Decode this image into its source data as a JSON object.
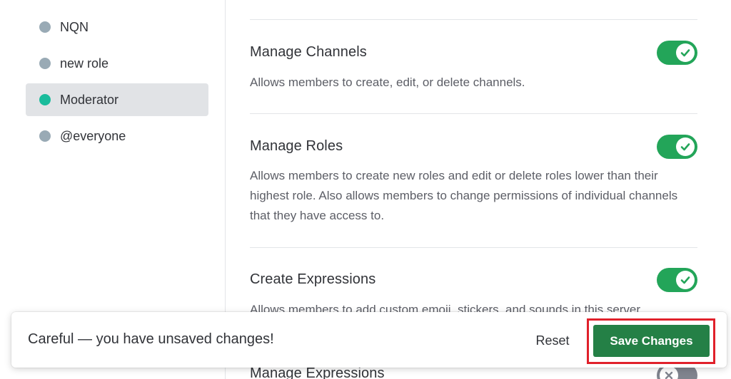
{
  "roles": [
    {
      "name": "NQN",
      "color": "#99aab5",
      "selected": false
    },
    {
      "name": "new role",
      "color": "#99aab5",
      "selected": false
    },
    {
      "name": "Moderator",
      "color": "#1abc9c",
      "selected": true
    },
    {
      "name": "@everyone",
      "color": "#99aab5",
      "selected": false
    }
  ],
  "permissions": [
    {
      "title": "Manage Channels",
      "description": "Allows members to create, edit, or delete channels.",
      "enabled": true
    },
    {
      "title": "Manage Roles",
      "description": "Allows members to create new roles and edit or delete roles lower than their highest role. Also allows members to change permissions of individual channels that they have access to.",
      "enabled": true
    },
    {
      "title": "Create Expressions",
      "description": "Allows members to add custom emoji, stickers, and sounds in this server.",
      "enabled": true
    },
    {
      "title": "Manage Expressions",
      "description": "",
      "enabled": false
    }
  ],
  "notice": {
    "message": "Careful — you have unsaved changes!",
    "reset_label": "Reset",
    "save_label": "Save Changes"
  },
  "colors": {
    "toggle_on": "#23a559",
    "toggle_off": "#80848e",
    "save_button": "#248046",
    "highlight_box": "#e0202a"
  }
}
